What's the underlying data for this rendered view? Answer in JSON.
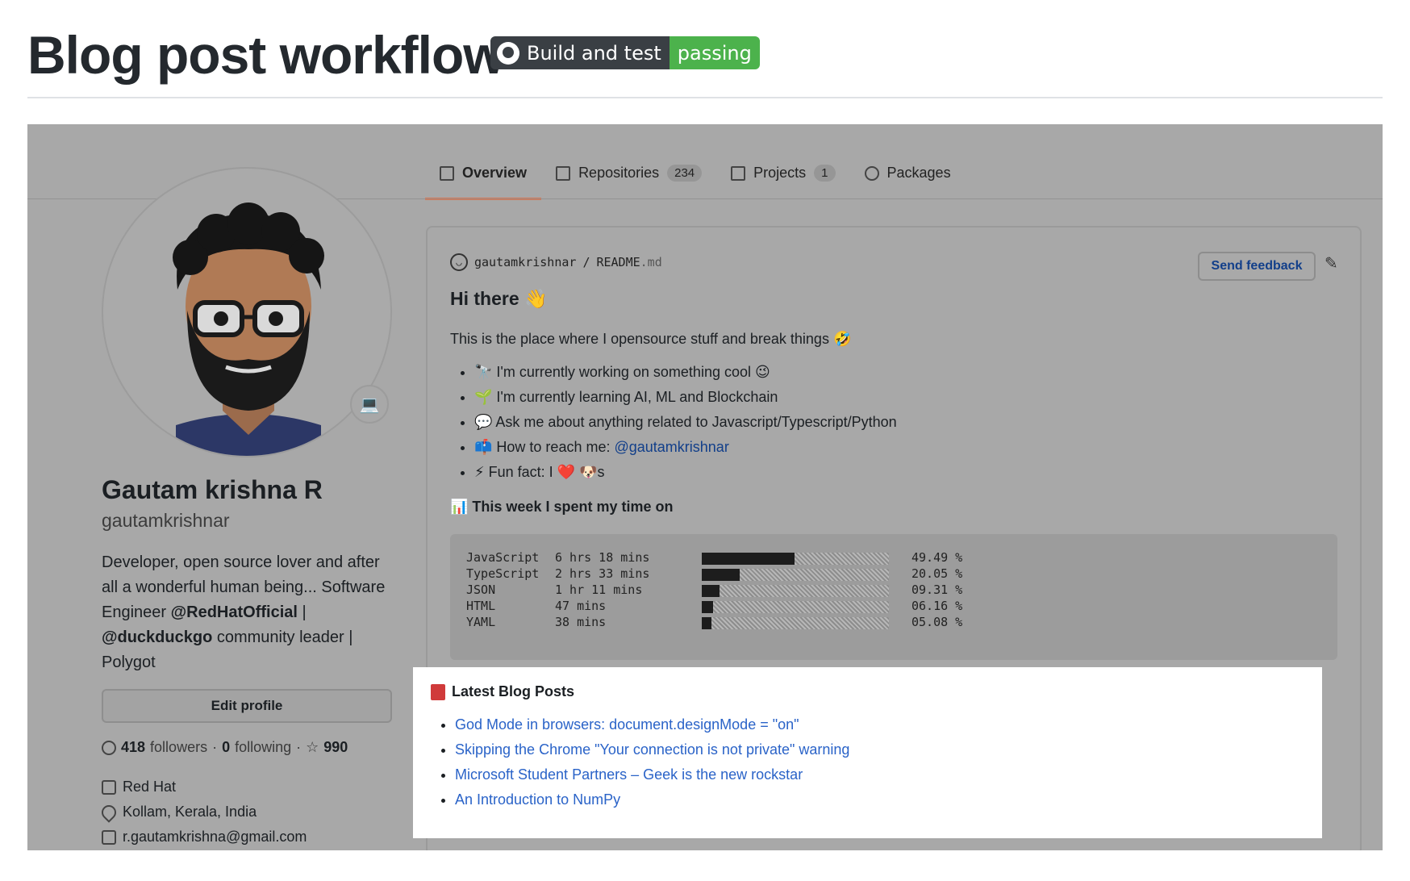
{
  "page": {
    "title": "Blog post workflow",
    "badge": {
      "label": "Build and test",
      "status": "passing",
      "status_color": "#4cb24c"
    }
  },
  "tabs": [
    {
      "label": "Overview",
      "icon": "book-icon",
      "count": ""
    },
    {
      "label": "Repositories",
      "icon": "repo-icon",
      "count": "234"
    },
    {
      "label": "Projects",
      "icon": "project-icon",
      "count": "1"
    },
    {
      "label": "Packages",
      "icon": "package-icon",
      "count": ""
    }
  ],
  "profile": {
    "status_emoji": "💻",
    "name": "Gautam krishna R",
    "login": "gautamkrishnar",
    "bio_parts": {
      "line1": "Developer, open source lover and after all a wonderful human being... Software Engineer ",
      "org1": "@RedHatOfficial",
      "sep1": " | ",
      "org2": "@duckduckgo",
      "line2": " community leader | Polygot"
    },
    "edit_profile": "Edit profile",
    "followers_count": "418",
    "followers_label": "followers",
    "dot1": "·",
    "following_count": "0",
    "following_label": "following",
    "dot2": "·",
    "stars": "990",
    "company": "Red Hat",
    "location": "Kollam, Kerala, India",
    "email": "r.gautamkrishna@gmail.com"
  },
  "readme": {
    "user": "gautamkrishnar",
    "slash": "/",
    "file": "README",
    "ext": ".md",
    "send_feedback": "Send feedback",
    "heading": "Hi there 👋",
    "intro": "This is the place where I opensource stuff and break things 🤣",
    "bullets": [
      "🔭 I'm currently working on something cool 😉",
      "🌱 I'm currently learning AI, ML and Blockchain",
      "💬 Ask me about anything related to Javascript/Typescript/Python"
    ],
    "reach_prefix": "📫 How to reach me: ",
    "reach_link": "@gautamkrishnar",
    "fun_fact": "⚡ Fun fact: I ❤️ 🐶s",
    "week_heading": "📊 This week I spent my time on",
    "stats": [
      {
        "lang": "JavaScript",
        "time": "6 hrs 18 mins",
        "pct": "49.49 %",
        "value": 49.49
      },
      {
        "lang": "TypeScript",
        "time": "2 hrs 33 mins",
        "pct": "20.05 %",
        "value": 20.05
      },
      {
        "lang": "JSON",
        "time": "1 hr 11 mins",
        "pct": "09.31 %",
        "value": 9.31
      },
      {
        "lang": "HTML",
        "time": "47 mins",
        "pct": "06.16 %",
        "value": 6.16
      },
      {
        "lang": "YAML",
        "time": "38 mins",
        "pct": "05.08 %",
        "value": 5.08
      }
    ]
  },
  "blog": {
    "heading": "Latest Blog Posts",
    "posts": [
      "God Mode in browsers: document.designMode = \"on\"",
      "Skipping the Chrome \"Your connection is not private\" warning",
      "Microsoft Student Partners – Geek is the new rockstar",
      "An Introduction to NumPy"
    ]
  }
}
